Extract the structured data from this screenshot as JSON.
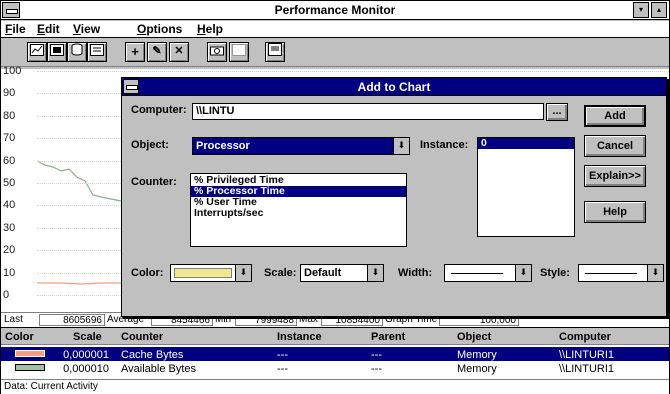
{
  "app": {
    "title": "Performance Monitor",
    "menu": [
      "File",
      "Edit",
      "View",
      "Options",
      "Help"
    ],
    "min_label": "▾",
    "max_label": "▴",
    "toolbar_glyphs": {
      "add": "+",
      "edit": "✎",
      "delete": "✕"
    }
  },
  "graph": {
    "yticks": [
      "100",
      "90",
      "80",
      "70",
      "60",
      "50",
      "40",
      "30",
      "20",
      "10",
      "0"
    ],
    "series_colors": {
      "available_bytes": "#8fae8f",
      "cache_bytes": "#f0a080"
    }
  },
  "statbar": {
    "last_label": "Last",
    "last_value": "8605696",
    "avg_label": "Average",
    "avg_value": "8454466",
    "min_label": "Min",
    "min_value": "7999488",
    "max_label": "Max",
    "max_value": "10854400",
    "graph_time_label": "Graph Time",
    "graph_time_value": "100,000"
  },
  "legend": {
    "headers": [
      "Color",
      "Scale",
      "Counter",
      "Instance",
      "Parent",
      "Object",
      "Computer"
    ],
    "rows": [
      {
        "color": "#f0a080",
        "scale": "0,000001",
        "counter": "Cache Bytes",
        "instance": "---",
        "parent": "---",
        "object": "Memory",
        "computer": "\\\\LINTURI1",
        "selected": true
      },
      {
        "color": "#a0c0a0",
        "scale": "0,000010",
        "counter": "Available Bytes",
        "instance": "---",
        "parent": "---",
        "object": "Memory",
        "computer": "\\\\LINTURI1",
        "selected": false
      }
    ]
  },
  "status": "Data: Current Activity",
  "dialog": {
    "title": "Add to Chart",
    "computer_label": "Computer:",
    "computer_value": "\\\\LINTU",
    "browse_label": "...",
    "object_label": "Object:",
    "object_value": "Processor",
    "instance_label": "Instance:",
    "instances": [
      "0"
    ],
    "counter_label": "Counter:",
    "counters": [
      "% Privileged Time",
      "% Processor Time",
      "% User Time",
      "Interrupts/sec"
    ],
    "selected_counter": 1,
    "color_label": "Color:",
    "color_value": "#f0e890",
    "scale_label": "Scale:",
    "scale_value": "Default",
    "width_label": "Width:",
    "style_label": "Style:",
    "buttons": {
      "add": "Add",
      "cancel": "Cancel",
      "explain": "Explain>>",
      "help": "Help"
    },
    "combo_arrow": "⬇"
  }
}
